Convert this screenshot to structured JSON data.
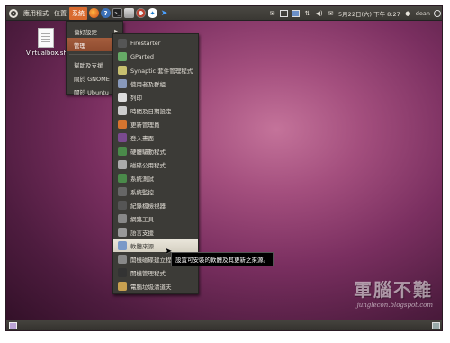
{
  "top_panel": {
    "menus": [
      "應用程式",
      "位置",
      "系統"
    ],
    "active_menu": "系統",
    "launchers": [
      "firefox",
      "help",
      "terminal",
      "app",
      "disk",
      "bird",
      "arrow"
    ],
    "clock": "5月22日(六) 下午 8:27",
    "user": "dean"
  },
  "desktop": {
    "file_label": "Virtualbox.sh"
  },
  "system_menu": {
    "items": [
      {
        "label": "偏好設定",
        "submenu": true,
        "highlight": false
      },
      {
        "label": "管理",
        "submenu": true,
        "highlight": true
      },
      {
        "label": "幫助及支援",
        "submenu": false,
        "highlight": false
      },
      {
        "label": "關於 GNOME",
        "submenu": false,
        "highlight": false
      },
      {
        "label": "關於 Ubuntu",
        "submenu": false,
        "highlight": false
      }
    ]
  },
  "admin_menu": {
    "items": [
      {
        "label": "Firestarter",
        "icon": "firestarter-icon",
        "color": "#555"
      },
      {
        "label": "GParted",
        "icon": "gparted-icon",
        "color": "#6a6"
      },
      {
        "label": "Synaptic 套件管理程式",
        "icon": "synaptic-icon",
        "color": "#c8c070"
      },
      {
        "label": "使用者及群組",
        "icon": "users-icon",
        "color": "#8899bb"
      },
      {
        "label": "列印",
        "icon": "printer-icon",
        "color": "#ddd"
      },
      {
        "label": "時間及日期設定",
        "icon": "clock-icon",
        "color": "#ccc"
      },
      {
        "label": "更新管理員",
        "icon": "update-icon",
        "color": "#d5742f"
      },
      {
        "label": "登入畫面",
        "icon": "login-icon",
        "color": "#7a4a90"
      },
      {
        "label": "硬體驅動程式",
        "icon": "hardware-icon",
        "color": "#4a8a4a"
      },
      {
        "label": "磁碟公用程式",
        "icon": "disk-utility-icon",
        "color": "#aaa"
      },
      {
        "label": "系統測試",
        "icon": "system-test-icon",
        "color": "#4a8a4a"
      },
      {
        "label": "系統監控",
        "icon": "monitor-icon",
        "color": "#666"
      },
      {
        "label": "紀錄檔檢視器",
        "icon": "log-viewer-icon",
        "color": "#555"
      },
      {
        "label": "網路工具",
        "icon": "network-tools-icon",
        "color": "#888"
      },
      {
        "label": "語言支援",
        "icon": "language-icon",
        "color": "#999"
      },
      {
        "label": "軟體來源",
        "icon": "software-sources-icon",
        "color": "#7a99c8",
        "hover": true
      },
      {
        "label": "開機磁碟建立程式",
        "icon": "startup-disk-icon",
        "color": "#888"
      },
      {
        "label": "開機管理程式",
        "icon": "boot-manager-icon",
        "color": "#333"
      },
      {
        "label": "電腦垃圾清道夫",
        "icon": "janitor-icon",
        "color": "#c8a050"
      }
    ]
  },
  "tooltip": {
    "text": "設置可安裝的軟體及其更新之來源。"
  },
  "watermark": {
    "logo_text": "軍腦不難",
    "signature": "junglecon.blogspot.com"
  }
}
